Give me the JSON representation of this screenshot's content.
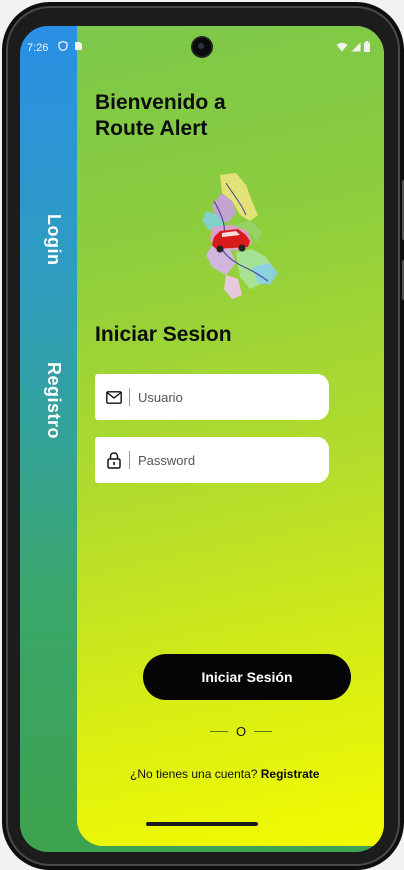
{
  "status_bar": {
    "time": "7:26"
  },
  "header": {
    "welcome_line1": "Bienvenido a",
    "welcome_line2": "Route Alert"
  },
  "side_nav": {
    "login_label": "Login",
    "register_label": "Registro"
  },
  "form": {
    "title": "Iniciar Sesion",
    "username_placeholder": "Usuario",
    "password_placeholder": "Password",
    "submit_label": "Iniciar Sesión",
    "separator_text": "O"
  },
  "footer": {
    "prompt": "¿No tienes una cuenta?",
    "register_link": "Registrate"
  },
  "icons": {
    "username_icon": "mail-icon",
    "password_icon": "lock-icon"
  },
  "colors": {
    "rail_top": "#2a8fe6",
    "rail_bottom": "#3ea34e",
    "card_top": "#7cc84a",
    "card_bottom": "#f4fb00",
    "button": "#050505"
  }
}
